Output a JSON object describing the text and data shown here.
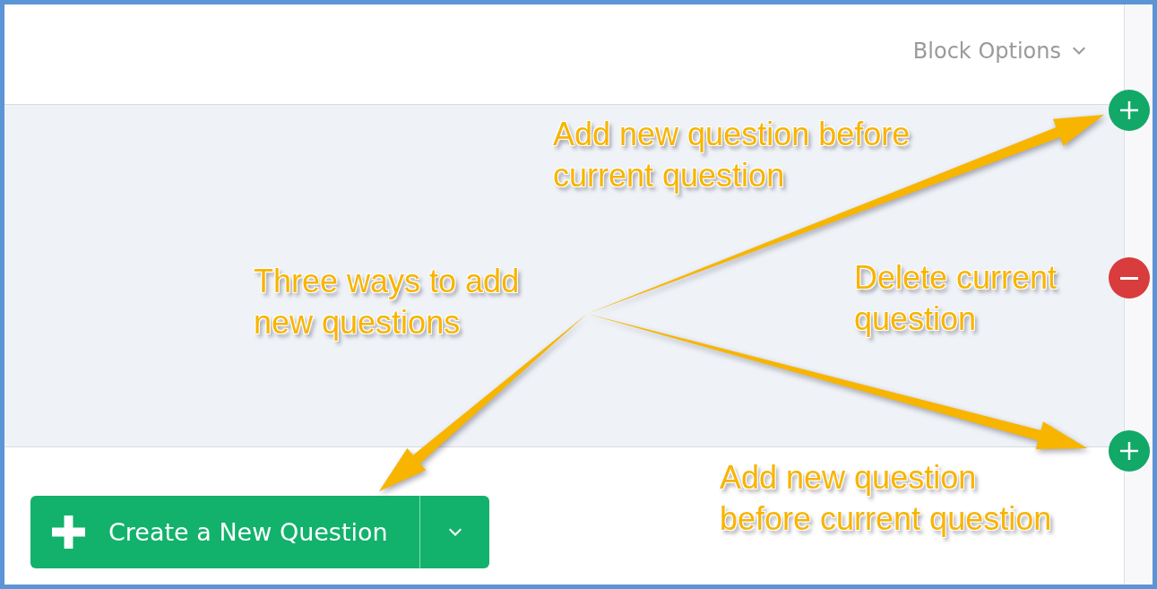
{
  "block_options": {
    "label": "Block Options"
  },
  "question_controls": [
    {
      "kind": "add"
    },
    {
      "kind": "delete"
    },
    {
      "kind": "add"
    }
  ],
  "create_button": {
    "label": "Create a New Question"
  },
  "annotations": [
    {
      "text": "Add new question before current question"
    },
    {
      "text": "Three ways to add new questions"
    },
    {
      "text": "Delete current question"
    },
    {
      "text": "Add new question before current question"
    }
  ]
}
